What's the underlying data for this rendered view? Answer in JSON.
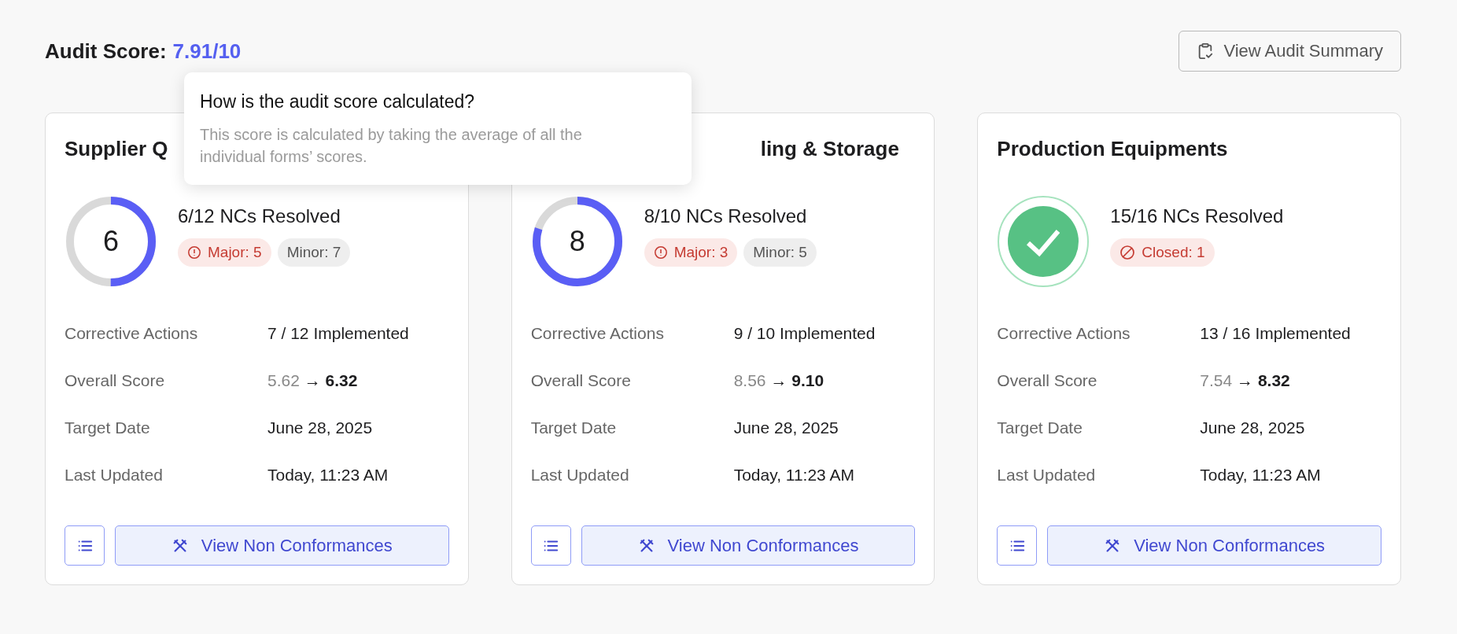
{
  "header": {
    "label": "Audit Score:",
    "score": "7.91/10"
  },
  "summary_button": {
    "label": "View Audit Summary"
  },
  "tooltip": {
    "title": "How is the audit score calculated?",
    "body": "This score is calculated by taking the average of all the individual forms’ scores."
  },
  "cards": [
    {
      "title": "Supplier Q",
      "status": {
        "kind": "ring",
        "level": 0.5,
        "value": "6"
      },
      "resolved": "6/12 NCs Resolved",
      "badges": [
        {
          "kind": "major",
          "label": "Major: 5"
        },
        {
          "kind": "minor",
          "label": "Minor: 7"
        }
      ],
      "rows": [
        {
          "kind": "text",
          "label": "Corrective Actions",
          "value": "7 / 12 Implemented"
        },
        {
          "kind": "score",
          "label": "Overall Score",
          "from": "5.62",
          "arrow": "→",
          "to": "6.32"
        },
        {
          "kind": "text",
          "label": "Target Date",
          "value": "June 28, 2025"
        },
        {
          "kind": "text",
          "label": "Last Updated",
          "value": "Today, 11:23 AM"
        }
      ],
      "button": "View Non Conformances"
    },
    {
      "title": "ling & Storage",
      "status": {
        "kind": "ring",
        "level": 0.8,
        "value": "8"
      },
      "resolved": "8/10 NCs Resolved",
      "badges": [
        {
          "kind": "major",
          "label": "Major: 3"
        },
        {
          "kind": "minor",
          "label": "Minor: 5"
        }
      ],
      "rows": [
        {
          "kind": "text",
          "label": "Corrective Actions",
          "value": "9 / 10 Implemented"
        },
        {
          "kind": "score",
          "label": "Overall Score",
          "from": "8.56",
          "arrow": "→",
          "to": "9.10"
        },
        {
          "kind": "text",
          "label": "Target Date",
          "value": "June 28, 2025"
        },
        {
          "kind": "text",
          "label": "Last Updated",
          "value": "Today, 11:23 AM"
        }
      ],
      "button": "View Non Conformances"
    },
    {
      "title": "Production Equipments",
      "status": {
        "kind": "check"
      },
      "resolved": "15/16 NCs Resolved",
      "badges": [
        {
          "kind": "closed",
          "label": "Closed: 1"
        }
      ],
      "rows": [
        {
          "kind": "text",
          "label": "Corrective Actions",
          "value": "13 / 16 Implemented"
        },
        {
          "kind": "score",
          "label": "Overall Score",
          "from": "7.54",
          "arrow": "→",
          "to": "8.32"
        },
        {
          "kind": "text",
          "label": "Target Date",
          "value": "June 28, 2025"
        },
        {
          "kind": "text",
          "label": "Last Updated",
          "value": "Today, 11:23 AM"
        }
      ],
      "button": "View Non Conformances"
    }
  ]
}
